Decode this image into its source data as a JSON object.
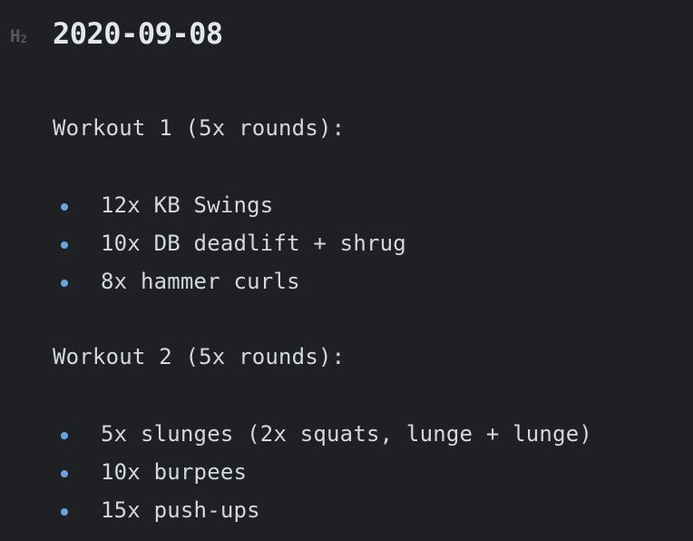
{
  "heading": {
    "marker": "H",
    "marker_sub": "2",
    "title": "2020-09-08"
  },
  "workouts": [
    {
      "title": "Workout 1 (5x rounds):",
      "items": [
        "12x KB Swings",
        "10x DB deadlift + shrug",
        "8x hammer curls"
      ]
    },
    {
      "title": "Workout 2 (5x rounds):",
      "items": [
        "5x slunges (2x squats, lunge + lunge)",
        "10x burpees",
        "15x push-ups"
      ]
    }
  ],
  "colors": {
    "background": "#1f2023",
    "text": "#d4d8dd",
    "bullet": "#6aa3e0",
    "heading_marker": "#55585d"
  }
}
